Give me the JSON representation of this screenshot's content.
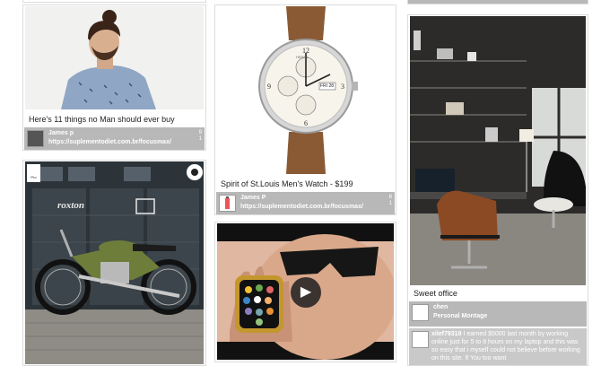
{
  "cards": {
    "fashion": {
      "caption": "Here's 11 things no Man should ever buy",
      "user": "James p",
      "link": "https://suplementodiet.com.br/focusmax/",
      "stat_top": "9",
      "stat_bottom": "1"
    },
    "watch": {
      "caption": "Spirit of St.Louis Men's Watch - $199",
      "user": "James P",
      "link": "https://suplementodiet.com.br/focusmax/",
      "stat_top": "8",
      "stat_bottom": "1",
      "dial_brand": "HENRY",
      "dial_date": "FRI 28"
    },
    "motorcycle": {
      "shop_sign": "roxton",
      "badge_left": "Pro",
      "icon_colors": {
        "paint": "#6e7d3a",
        "wall": "#2b3237"
      }
    },
    "video": {
      "play_label": "▶"
    },
    "office": {
      "caption": "Sweet office",
      "user": "chen",
      "board": "Personal Montage",
      "comment_user": "xilef79318",
      "comment_text": "I earned $5000 last month by working online just for 5 to 8 hours on my laptop and this was so easy that i myself could not believe before working on this site. If You too want"
    }
  }
}
